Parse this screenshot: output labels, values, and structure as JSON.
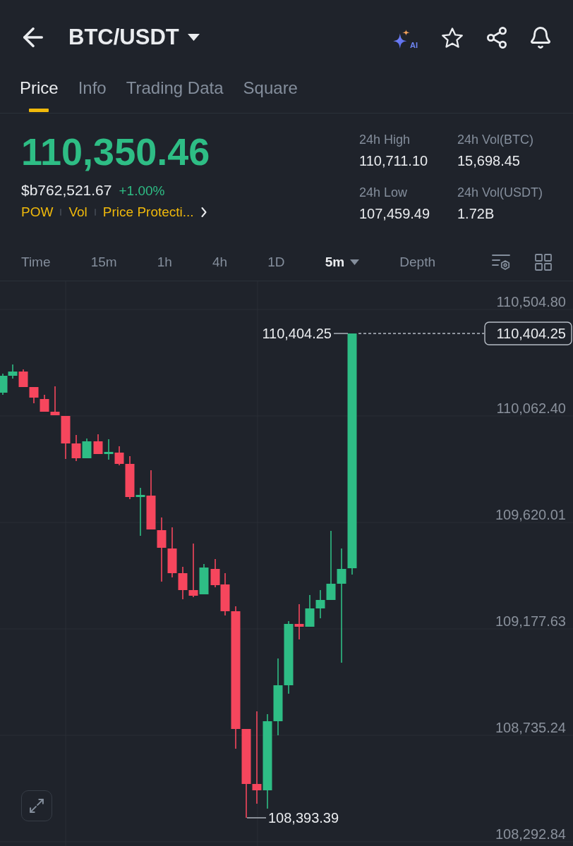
{
  "header": {
    "title": "BTC/USDT",
    "ai_label": "AI"
  },
  "tabs": [
    {
      "label": "Price",
      "selected": true
    },
    {
      "label": "Info",
      "selected": false
    },
    {
      "label": "Trading Data",
      "selected": false
    },
    {
      "label": "Square",
      "selected": false
    }
  ],
  "ticker": {
    "last_price": "110,350.46",
    "positive": true,
    "fiat_price": "$b762,521.67",
    "change": "+1.00%",
    "tags": [
      "POW",
      "Vol",
      "Price Protecti..."
    ]
  },
  "stats": [
    {
      "label": "24h High",
      "value": "110,711.10"
    },
    {
      "label": "24h Vol(BTC)",
      "value": "15,698.45"
    },
    {
      "label": "24h Low",
      "value": "107,459.49"
    },
    {
      "label": "24h Vol(USDT)",
      "value": "1.72B"
    }
  ],
  "intervals": [
    {
      "label": "Time",
      "kind": "option",
      "selected": false
    },
    {
      "label": "15m",
      "kind": "option",
      "selected": false
    },
    {
      "label": "1h",
      "kind": "option",
      "selected": false
    },
    {
      "label": "4h",
      "kind": "option",
      "selected": false
    },
    {
      "label": "1D",
      "kind": "option",
      "selected": false
    },
    {
      "label": "5m",
      "kind": "menu",
      "selected": true
    },
    {
      "label": "Depth",
      "kind": "option",
      "selected": false
    }
  ],
  "chart": {
    "y_axis_labels": [
      "110,504.80",
      "110,062.40",
      "109,620.01",
      "109,177.63",
      "108,735.24",
      "108,292.84"
    ],
    "high_label": "110,404.25",
    "low_label": "108,393.39",
    "last_price_tag": "110,404.25"
  }
}
